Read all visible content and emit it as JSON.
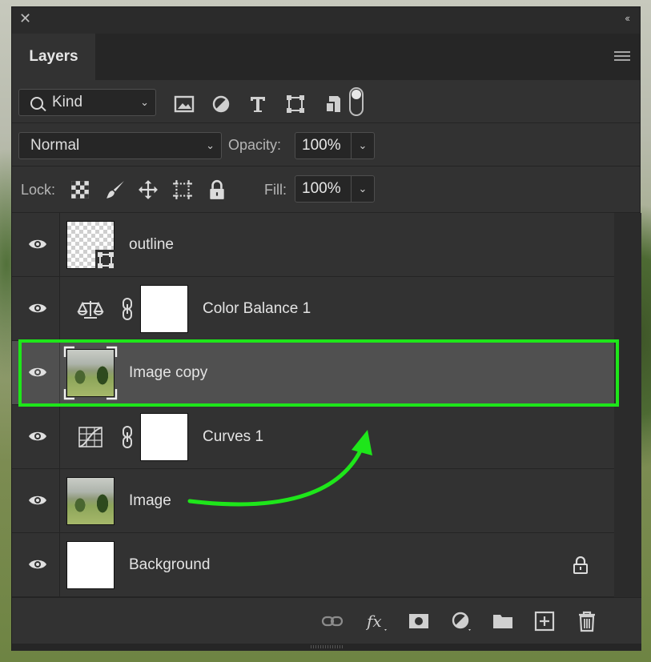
{
  "panel": {
    "tab_title": "Layers"
  },
  "filter": {
    "kind_label": "Kind",
    "kind_chevron": "⌄"
  },
  "blend": {
    "mode": "Normal",
    "opacity_label": "Opacity:",
    "opacity_value": "100%"
  },
  "lock": {
    "label": "Lock:",
    "fill_label": "Fill:",
    "fill_value": "100%"
  },
  "layers": [
    {
      "name": "outline",
      "type": "shape",
      "visible": true
    },
    {
      "name": "Color Balance 1",
      "type": "adjustment-color-balance",
      "visible": true
    },
    {
      "name": "Image copy",
      "type": "smart-object",
      "visible": true,
      "selected": true
    },
    {
      "name": "Curves 1",
      "type": "adjustment-curves",
      "visible": true
    },
    {
      "name": "Image",
      "type": "image",
      "visible": true
    },
    {
      "name": "Background",
      "type": "background",
      "visible": true,
      "locked": true
    }
  ],
  "annotations": {
    "highlight_color": "#1ee61a",
    "arrow_color": "#1ee61a"
  },
  "icons": {
    "filter": [
      "image-filter-icon",
      "adjustment-filter-icon",
      "type-filter-icon",
      "shape-filter-icon",
      "smart-object-filter-icon"
    ],
    "lock": [
      "lock-transparent-pixels-icon",
      "lock-image-pixels-icon",
      "lock-position-icon",
      "lock-artboard-icon",
      "lock-all-icon"
    ],
    "footer": [
      "link-layers-icon",
      "fx-icon",
      "add-mask-icon",
      "new-fill-adjustment-icon",
      "new-group-icon",
      "new-layer-icon",
      "delete-layer-icon"
    ]
  }
}
